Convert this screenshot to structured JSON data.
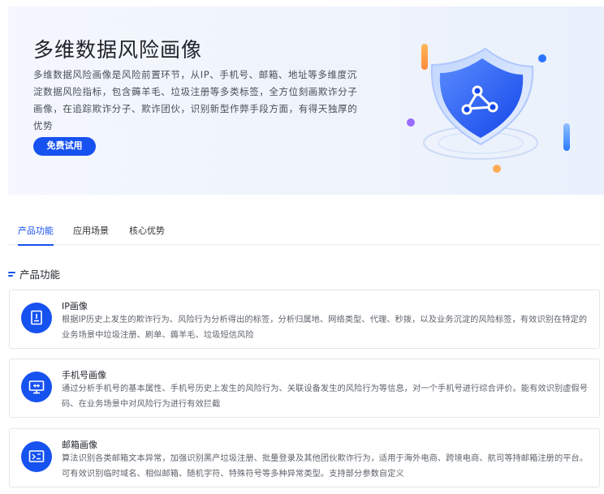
{
  "hero": {
    "title": "多维数据风险画像",
    "description": "多维数据风险画像是风险前置环节，从IP、手机号、邮箱、地址等多维度沉淀数据风险指标，包含薅羊毛、垃圾注册等多类标签，全方位刻画欺诈分子画像，在追踪欺诈分子、欺诈团伙，识别新型作弊手段方面，有得天独厚的优势",
    "trial_button": "免费试用",
    "art_icon": "shield-network-icon"
  },
  "tabs": [
    {
      "label": "产品功能",
      "active": true
    },
    {
      "label": "应用场景",
      "active": false
    },
    {
      "label": "核心优势",
      "active": false
    }
  ],
  "section": {
    "title": "产品功能"
  },
  "cards": [
    {
      "icon": "ip-document-icon",
      "title": "IP画像",
      "description": "根据IP历史上发生的欺诈行为、风险行为分析得出的标签，分析归属地、网络类型、代理、秒拨，以及业务沉淀的风险标签，有效识别在特定的业务场景中垃圾注册、刷单、薅羊毛、垃圾短信风险"
    },
    {
      "icon": "phone-monitor-icon",
      "title": "手机号画像",
      "description": "通过分析手机号的基本属性、手机号历史上发生的风险行为、关联设备发生的风险行为等信息，对一个手机号进行综合评价。能有效识别虚假号码、在业务场景中对风险行为进行有效拦截"
    },
    {
      "icon": "email-screen-icon",
      "title": "邮箱画像",
      "description": "算法识别各类邮箱文本异常，加强识别黑产垃圾注册、批量登录及其他团伙欺诈行为，适用于海外电商、跨境电商、航司等持邮箱注册的平台。可有效识别临时域名、相似邮箱、随机字符、特殊符号等多种异常类型。支持部分参数自定义"
    }
  ],
  "colors": {
    "accent": "#1652f0",
    "hero_bg": "#eef3fc",
    "text_dark": "#1f2329",
    "text_body": "#5d636b"
  }
}
